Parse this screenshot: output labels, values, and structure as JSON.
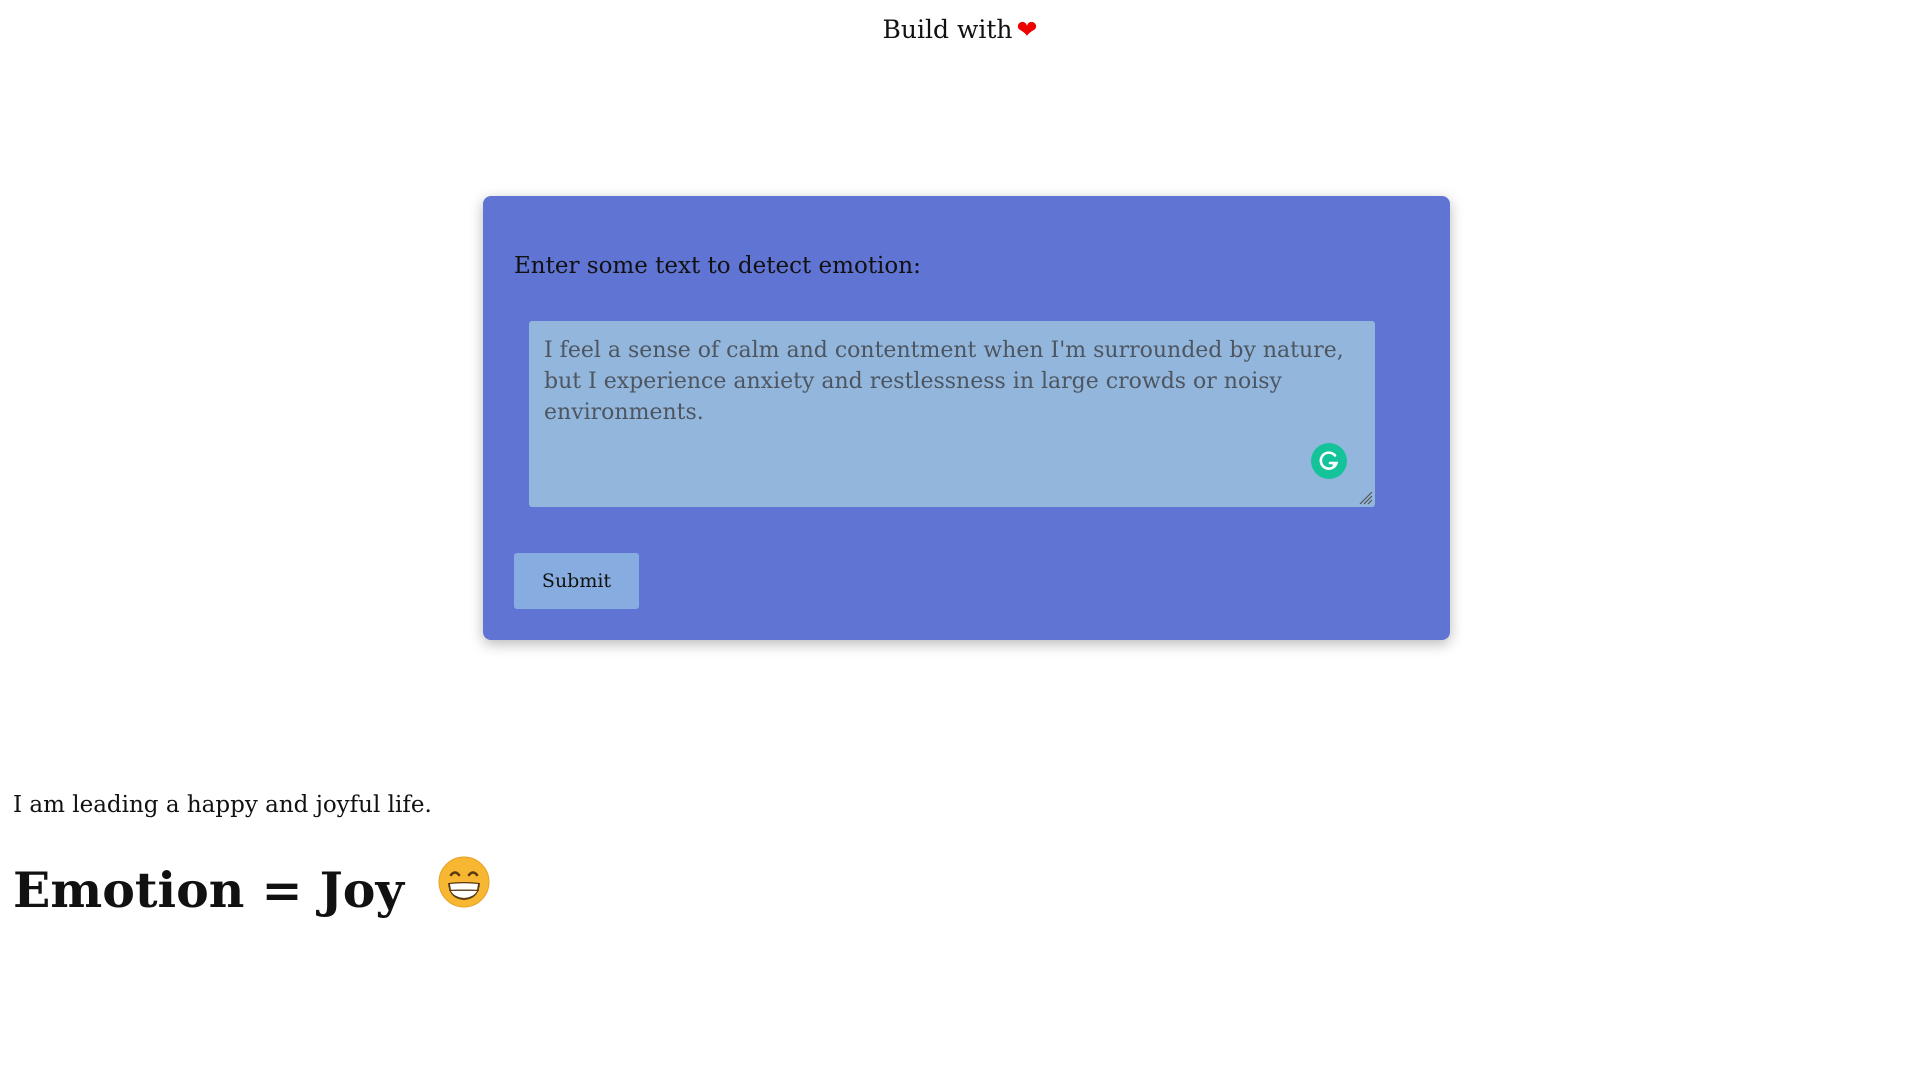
{
  "header": {
    "text": "Build with",
    "heart_icon": "❤"
  },
  "form": {
    "label": "Enter some text to detect emotion:",
    "textarea_value": "I feel a sense of calm and contentment when I'm surrounded by nature, but I experience anxiety and restlessness in large crowds or noisy environments.",
    "submit_label": "Submit",
    "grammarly_icon": "grammarly-icon",
    "colors": {
      "card_bg": "#6074d3",
      "textarea_bg": "#93b7dc",
      "button_bg": "#87acdf",
      "grammarly": "#15c39a"
    }
  },
  "result": {
    "input_text": "I am leading a happy and joyful life.",
    "emotion_text": "Emotion = Joy",
    "emoji_icon": "grinning-face-icon"
  }
}
